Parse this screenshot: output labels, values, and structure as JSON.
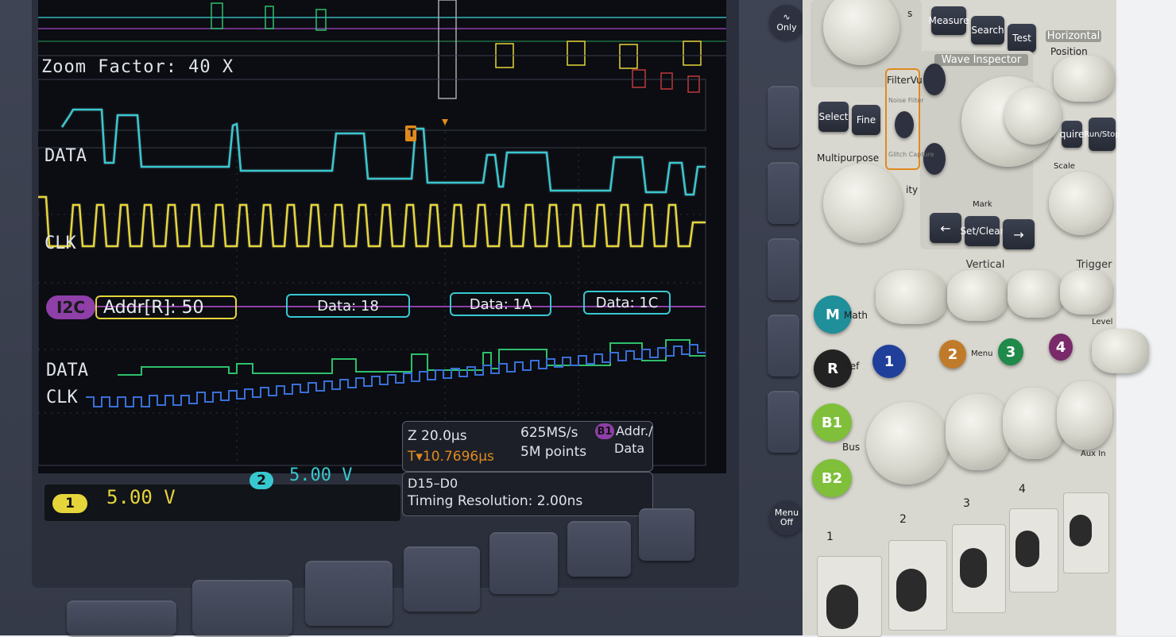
{
  "screen": {
    "zoom_factor": "Zoom Factor: 40 X",
    "trigger_marker": "T",
    "traces": {
      "analog_data_label": "DATA",
      "analog_clk_label": "CLK",
      "digital_data_label": "DATA",
      "digital_clk_label": "CLK"
    },
    "bus": {
      "tag": "I2C",
      "packets": [
        "Addr[R]: 50",
        "Data: 18",
        "Data: 1A",
        "Data: 1C"
      ]
    },
    "readouts": {
      "ch1_badge": "1",
      "ch1_scale": "5.00 V",
      "ch2_badge": "2",
      "ch2_scale": "5.00 V",
      "zoom_time": "Z 20.0µs",
      "trigger_pos": "10.7696µs",
      "sample_rate": "625MS/s",
      "record_length": "5M points",
      "bus_badge": "B1",
      "bus_decode_line1": "Addr./",
      "bus_decode_line2": "Data",
      "digital_range": "D15–D0",
      "timing_resolution": "Timing Resolution: 2.00ns"
    },
    "colors": {
      "ch1": "#e6d53a",
      "ch2": "#38c8d0",
      "bus": "#8e3fa8",
      "digital_green": "#2fbf6a",
      "digital_blue": "#3a6fd8"
    }
  },
  "side_buttons": {
    "only": "Only",
    "menu_off_line1": "Menu",
    "menu_off_line2": "Off"
  },
  "panel": {
    "buttons": {
      "measure": "Measure",
      "search": "Search",
      "test": "Test",
      "select": "Select",
      "fine": "Fine",
      "set_clear": "Set/Clear",
      "acquire": "quire",
      "run_stop": "Run/Stop"
    },
    "labels": {
      "horizontal": "Horizontal",
      "position": "Position",
      "scale": "Scale",
      "wave_inspector": "Wave Inspector",
      "filtervu": "FilterVu",
      "noise_filter": "Noise Filter",
      "glitch_capture": "Glitch Capture",
      "multipurpose": "Multipurpose",
      "mark": "Mark",
      "vertical": "Vertical",
      "trigger": "Trigger",
      "level": "Level",
      "math": "Math",
      "ref": "Ref",
      "menu": "Menu",
      "bus": "Bus",
      "aux_in": "Aux In",
      "partial_s": "s",
      "partial_ity": "ity"
    },
    "channel_buttons": {
      "m": "M",
      "r": "R",
      "b1": "B1",
      "b2": "B2",
      "c1": "1",
      "c2": "2",
      "c3": "3",
      "c4": "4"
    },
    "input_labels": [
      "1",
      "2",
      "3",
      "4"
    ],
    "colors": {
      "m_teal": "#1f8f9a",
      "ch1_blue": "#1f3f9a",
      "ch2_orange": "#c07b2a",
      "ch3_green": "#1f8a4a",
      "ch4_purple": "#7a2a6a",
      "bus_green": "#7fbf3a",
      "ref_black": "#222222"
    }
  }
}
